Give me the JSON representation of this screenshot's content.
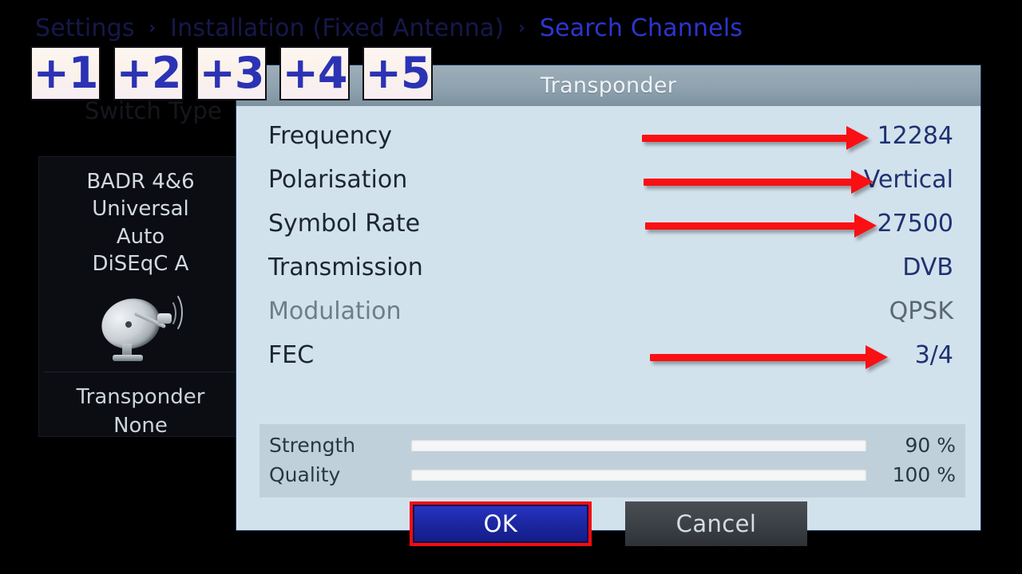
{
  "breadcrumb": {
    "items": [
      "Settings",
      "Installation (Fixed Antenna)",
      "Search Channels"
    ],
    "separator": "›",
    "item0": "Settings",
    "item1": "Installation (Fixed Antenna)",
    "item2": "Search Channels"
  },
  "background_menu": {
    "switch_type_label": "Switch Type"
  },
  "sidebar": {
    "satellite": "BADR 4&6",
    "lnb_type": "Universal",
    "lnb_power": "Auto",
    "diseqc": "DiSEqC A",
    "dish_icon": "satellite-dish-icon",
    "transponder_label": "Transponder",
    "transponder_value": "None"
  },
  "dialog": {
    "title": "Transponder",
    "rows": [
      {
        "label": "Frequency",
        "value": "12284",
        "dimmed": false,
        "arrow": true
      },
      {
        "label": "Polarisation",
        "value": "Vertical",
        "dimmed": false,
        "arrow": true
      },
      {
        "label": "Symbol Rate",
        "value": "27500",
        "dimmed": false,
        "arrow": true
      },
      {
        "label": "Transmission",
        "value": "DVB",
        "dimmed": false,
        "arrow": false
      },
      {
        "label": "Modulation",
        "value": "QPSK",
        "dimmed": true,
        "arrow": false
      },
      {
        "label": "FEC",
        "value": "3/4",
        "dimmed": false,
        "arrow": true
      }
    ],
    "meters": [
      {
        "label": "Strength",
        "percent_text": "90 %",
        "percent": 90,
        "color": "#c2690a"
      },
      {
        "label": "Quality",
        "percent_text": "100 %",
        "percent": 100,
        "color": "#51980f"
      }
    ],
    "buttons": {
      "ok": "OK",
      "cancel": "Cancel"
    }
  },
  "overlay_badges": [
    "+1",
    "+2",
    "+3",
    "+4",
    "+5"
  ],
  "colors": {
    "dialog_background": "#d2e2ed",
    "title_bar": "#8fa2af",
    "value_text": "#1f3170",
    "arrow_red": "#fa0f13",
    "ok_button": "#1d28a4",
    "ok_highlight": "#f50c10",
    "strength_bar": "#c2690a",
    "quality_bar": "#51980f",
    "badge_text": "#2b33b4"
  }
}
